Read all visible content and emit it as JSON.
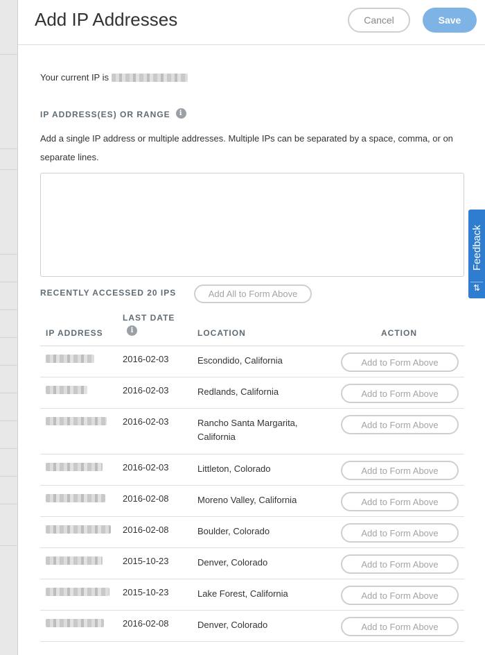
{
  "modal": {
    "title": "Add IP Addresses",
    "cancel_label": "Cancel",
    "save_label": "Save"
  },
  "current_ip": {
    "prefix": "Your current IP is"
  },
  "ip_section": {
    "label": "IP ADDRESS(ES) OR RANGE",
    "description": "Add a single IP address or multiple addresses. Multiple IPs can be separated by a space, comma, or on separate lines.",
    "textarea_value": ""
  },
  "recent": {
    "label": "RECENTLY ACCESSED 20 IPS",
    "add_all_label": "Add All to Form Above"
  },
  "table": {
    "headers": {
      "ip": "IP ADDRESS",
      "date": "LAST DATE",
      "location": "LOCATION",
      "action": "ACTION"
    },
    "rows": [
      {
        "date": "2016-02-03",
        "location": "Escondido, California",
        "action": "Add to Form Above"
      },
      {
        "date": "2016-02-03",
        "location": "Redlands, California",
        "action": "Add to Form Above"
      },
      {
        "date": "2016-02-03",
        "location": "Rancho Santa Margarita, California",
        "action": "Add to Form Above"
      },
      {
        "date": "2016-02-03",
        "location": "Littleton, Colorado",
        "action": "Add to Form Above"
      },
      {
        "date": "2016-02-08",
        "location": "Moreno Valley, California",
        "action": "Add to Form Above"
      },
      {
        "date": "2016-02-08",
        "location": "Boulder, Colorado",
        "action": "Add to Form Above"
      },
      {
        "date": "2015-10-23",
        "location": "Denver, Colorado",
        "action": "Add to Form Above"
      },
      {
        "date": "2015-10-23",
        "location": "Lake Forest, California",
        "action": "Add to Form Above"
      },
      {
        "date": "2016-02-08",
        "location": "Denver, Colorado",
        "action": "Add to Form Above"
      }
    ]
  },
  "feedback": {
    "label": "Feedback",
    "icon": "sort-arrows-icon"
  },
  "colors": {
    "save_button": "#7eb3e6",
    "feedback_tab": "#2e7dd1",
    "label_text": "#5f6b75"
  }
}
